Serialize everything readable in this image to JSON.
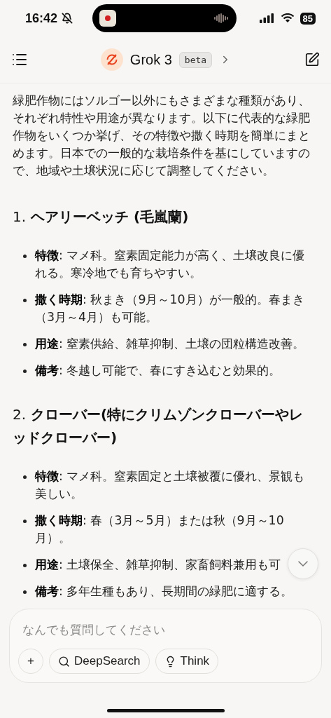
{
  "status_bar": {
    "time": "16:42",
    "battery": "85",
    "silent": true
  },
  "header": {
    "title": "Grok 3",
    "badge": "beta"
  },
  "intro": "緑肥作物にはソルゴー以外にもさまざまな種類があり、それぞれ特性や用途が異なります。以下に代表的な緑肥作物をいくつか挙げ、その特徴や撒く時期を簡単にまとめます。日本での一般的な栽培条件を基にしていますので、地域や土壌状況に応じて調整してください。",
  "sections": [
    {
      "number": "1.",
      "title": "ヘアリーベッチ (毛嵐蘭)",
      "bullets": [
        "**特徴**: マメ科。窒素固定能力が高く、土壌改良に優れる。寒冷地でも育ちやすい。",
        "**撒く時期**: 秋まき（9月～10月）が一般的。春まき（3月～4月）も可能。",
        "**用途**: 窒素供給、雑草抑制、土壌の団粒構造改善。",
        "**備考**: 冬越し可能で、春にすき込むと効果的。"
      ]
    },
    {
      "number": "2.",
      "title": "クローバー(特にクリムゾンクローバーやレッドクローバー)",
      "bullets": [
        "**特徴**: マメ科。窒素固定と土壌被覆に優れ、景観も美しい。",
        "**撒く時期**: 春（3月～5月）または秋（9月～10月）。",
        "**用途**: 土壌保全、雑草抑制、家畜飼料兼用も可",
        "**備考**: 多年生種もあり、長期間の緑肥に適する。"
      ]
    }
  ],
  "composer": {
    "placeholder": "なんでも質問してください",
    "buttons": [
      {
        "kind": "plus",
        "label": "+"
      },
      {
        "kind": "search",
        "label": "DeepSearch"
      },
      {
        "kind": "think",
        "label": "Think"
      }
    ]
  }
}
